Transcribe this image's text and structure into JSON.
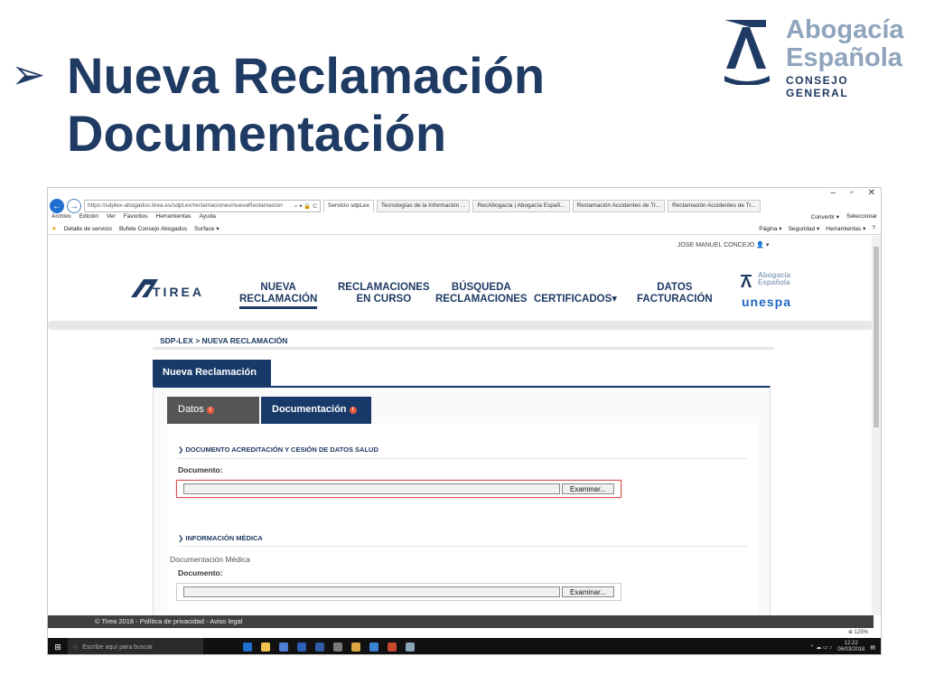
{
  "slide": {
    "arrow": "➢",
    "title_line1": "Nueva Reclamación",
    "title_line2": "Documentación",
    "logo": {
      "line1": "Abogacía",
      "line2": "Española",
      "sub": "CONSEJO GENERAL"
    }
  },
  "browser": {
    "window_controls": [
      "–",
      "▫",
      "✕"
    ],
    "address": "https://sdplex-abogados.tirea.es/sdpLex/reclamaciones/nuevaReclamacion",
    "address_icons": "⌕ ▾ 🔒 C",
    "tabs": [
      "Servicio sdpLex",
      "Tecnologías de la Información ...",
      "RecAbogacía | Abogacía Españ...",
      "Reclamación Accidentes de Tr...",
      "Reclamación Accidentes de Tr..."
    ],
    "menu": [
      "Archivo",
      "Edición",
      "Ver",
      "Favoritos",
      "Herramientas",
      "Ayuda"
    ],
    "menu_right": [
      "Convertir ▾",
      "Seleccionar"
    ],
    "favorites": [
      "Detalle de servicio",
      "Bufete Consejo Abogados",
      "Surface ▾"
    ],
    "favorites_right": [
      "Página ▾",
      "Seguridad ▾",
      "Herramientas ▾",
      "?"
    ]
  },
  "page": {
    "user": "JOSE MANUEL CONCEJO",
    "tirea": "TIREA",
    "nav": [
      {
        "line1": "NUEVA",
        "line2": "RECLAMACIÓN"
      },
      {
        "line1": "RECLAMACIONES",
        "line2": "EN CURSO"
      },
      {
        "line1": "BÚSQUEDA",
        "line2": "RECLAMACIONES"
      },
      {
        "line1": "CERTIFICADOS",
        "line2": ""
      },
      {
        "line1": "DATOS",
        "line2": "FACTURACIÓN"
      }
    ],
    "partner1_line1": "Abogacía",
    "partner1_line2": "Española",
    "partner2": "unespa",
    "breadcrumb": "SDP-LEX > NUEVA RECLAMACIÓN",
    "panel_title": "Nueva Reclamación",
    "subtabs": {
      "datos": "Datos",
      "documentacion": "Documentación",
      "warn": "!"
    },
    "section1": {
      "heading": "DOCUMENTO ACREDITACIÓN Y CESIÓN DE DATOS SALUD",
      "field_label": "Documento:",
      "button": "Examinar..."
    },
    "section2": {
      "heading": "INFORMACIÓN MÉDICA",
      "group_label": "Documentación Médica",
      "field_label": "Documento:",
      "button": "Examinar..."
    },
    "footer": "© Tirea 2018 - Política de privacidad - Aviso legal",
    "zoom": "125%"
  },
  "taskbar": {
    "search_placeholder": "Escribe aquí para buscar",
    "time": "12:22",
    "date": "06/03/2018"
  },
  "colors": {
    "brand_navy": "#1f3b63",
    "tab_navy": "#183a69",
    "error_red": "#d9534f",
    "unespa_blue": "#1f66c3"
  }
}
